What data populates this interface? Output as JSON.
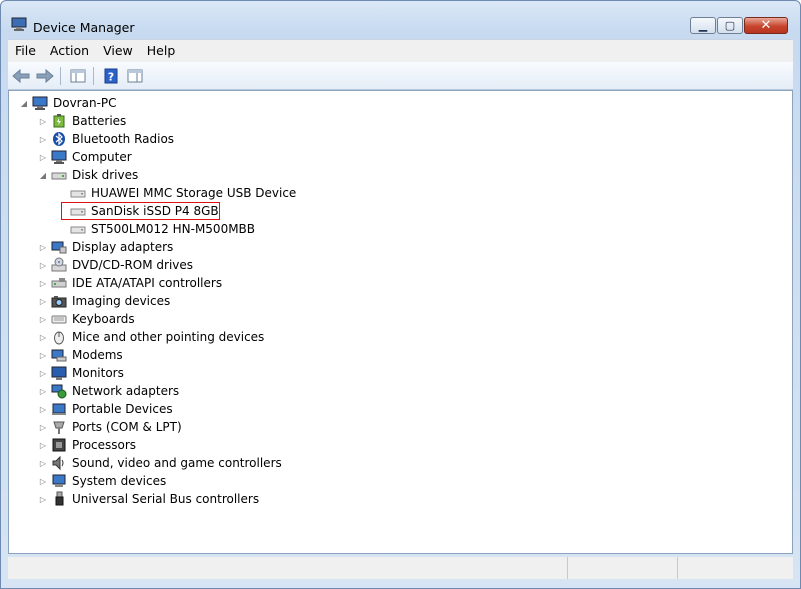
{
  "window": {
    "title": "Device Manager"
  },
  "menu": [
    "File",
    "Action",
    "View",
    "Help"
  ],
  "tree": {
    "root": "Dovran-PC",
    "categories": [
      {
        "label": "Batteries",
        "icon": "battery-icon"
      },
      {
        "label": "Bluetooth Radios",
        "icon": "bluetooth-icon"
      },
      {
        "label": "Computer",
        "icon": "computer-icon"
      },
      {
        "label": "Disk drives",
        "icon": "disk-drive-icon",
        "expanded": true,
        "children": [
          "HUAWEI MMC Storage USB Device",
          "SanDisk iSSD P4 8GB",
          "ST500LM012 HN-M500MBB"
        ]
      },
      {
        "label": "Display adapters",
        "icon": "display-adapter-icon"
      },
      {
        "label": "DVD/CD-ROM drives",
        "icon": "dvd-drive-icon"
      },
      {
        "label": "IDE ATA/ATAPI controllers",
        "icon": "ide-controller-icon"
      },
      {
        "label": "Imaging devices",
        "icon": "camera-icon"
      },
      {
        "label": "Keyboards",
        "icon": "keyboard-icon"
      },
      {
        "label": "Mice and other pointing devices",
        "icon": "mouse-icon"
      },
      {
        "label": "Modems",
        "icon": "modem-icon"
      },
      {
        "label": "Monitors",
        "icon": "monitor-icon"
      },
      {
        "label": "Network adapters",
        "icon": "network-icon"
      },
      {
        "label": "Portable Devices",
        "icon": "portable-device-icon"
      },
      {
        "label": "Ports (COM & LPT)",
        "icon": "port-icon"
      },
      {
        "label": "Processors",
        "icon": "processor-icon"
      },
      {
        "label": "Sound, video and game controllers",
        "icon": "speaker-icon"
      },
      {
        "label": "System devices",
        "icon": "system-device-icon"
      },
      {
        "label": "Universal Serial Bus controllers",
        "icon": "usb-icon"
      }
    ]
  },
  "highlighted_item": "SanDisk iSSD P4 8GB",
  "colors": {
    "highlight_border": "#dd1111",
    "close_button": "#c7442d"
  }
}
